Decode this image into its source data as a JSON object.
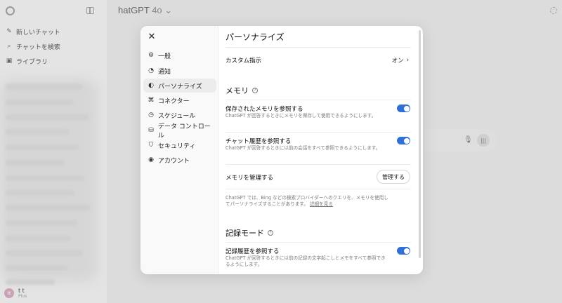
{
  "app": {
    "model_name": "hatGPT",
    "model_version": "4o",
    "nav": [
      {
        "icon": "edit-icon",
        "label": "新しいチャット"
      },
      {
        "icon": "search-icon",
        "label": "チャットを検索"
      },
      {
        "icon": "library-icon",
        "label": "ライブラリ"
      }
    ],
    "user": {
      "initials": "tt",
      "name": "t t",
      "plan": "Plus"
    }
  },
  "settings": {
    "menu": [
      {
        "icon": "gear-icon",
        "label": "一般"
      },
      {
        "icon": "bell-icon",
        "label": "通知"
      },
      {
        "icon": "personalize-icon",
        "label": "パーソナライズ",
        "active": true
      },
      {
        "icon": "connector-icon",
        "label": "コネクター"
      },
      {
        "icon": "clock-icon",
        "label": "スケジュール"
      },
      {
        "icon": "database-icon",
        "label": "データ コントロール"
      },
      {
        "icon": "shield-icon",
        "label": "セキュリティ"
      },
      {
        "icon": "account-icon",
        "label": "アカウント"
      }
    ],
    "panel": {
      "title": "パーソナライズ",
      "custom_instructions": {
        "label": "カスタム指示",
        "value": "オン"
      },
      "memory_heading": "メモリ",
      "saved_memory": {
        "label": "保存されたメモリを参照する",
        "desc": "ChatGPT が回答するときにメモリを保存して使用できるようにします。",
        "enabled": true
      },
      "chat_history": {
        "label": "チャット履歴を参照する",
        "desc": "ChatGPT が回答するときに以前の会話をすべて参照できるようにします。",
        "enabled": true
      },
      "manage_memory": {
        "label": "メモリを管理する",
        "button": "管理する"
      },
      "memory_note": "ChatGPT では、Bing などの検索プロバイダーへのクエリを、メモリを使用してパーソナライズすることがあります。",
      "memory_note_link": "詳細を見る",
      "record_heading": "記録モード",
      "record_history": {
        "label": "記録履歴を参照する",
        "desc": "ChatGPT が回答するときに以前の記録の文字起こしとメモをすべて参照できるようにします。",
        "enabled": true
      }
    }
  },
  "colors": {
    "toggle_on": "#2f6fd6",
    "modal_bg": "#ffffff",
    "overlay": "#d9d9d9"
  }
}
